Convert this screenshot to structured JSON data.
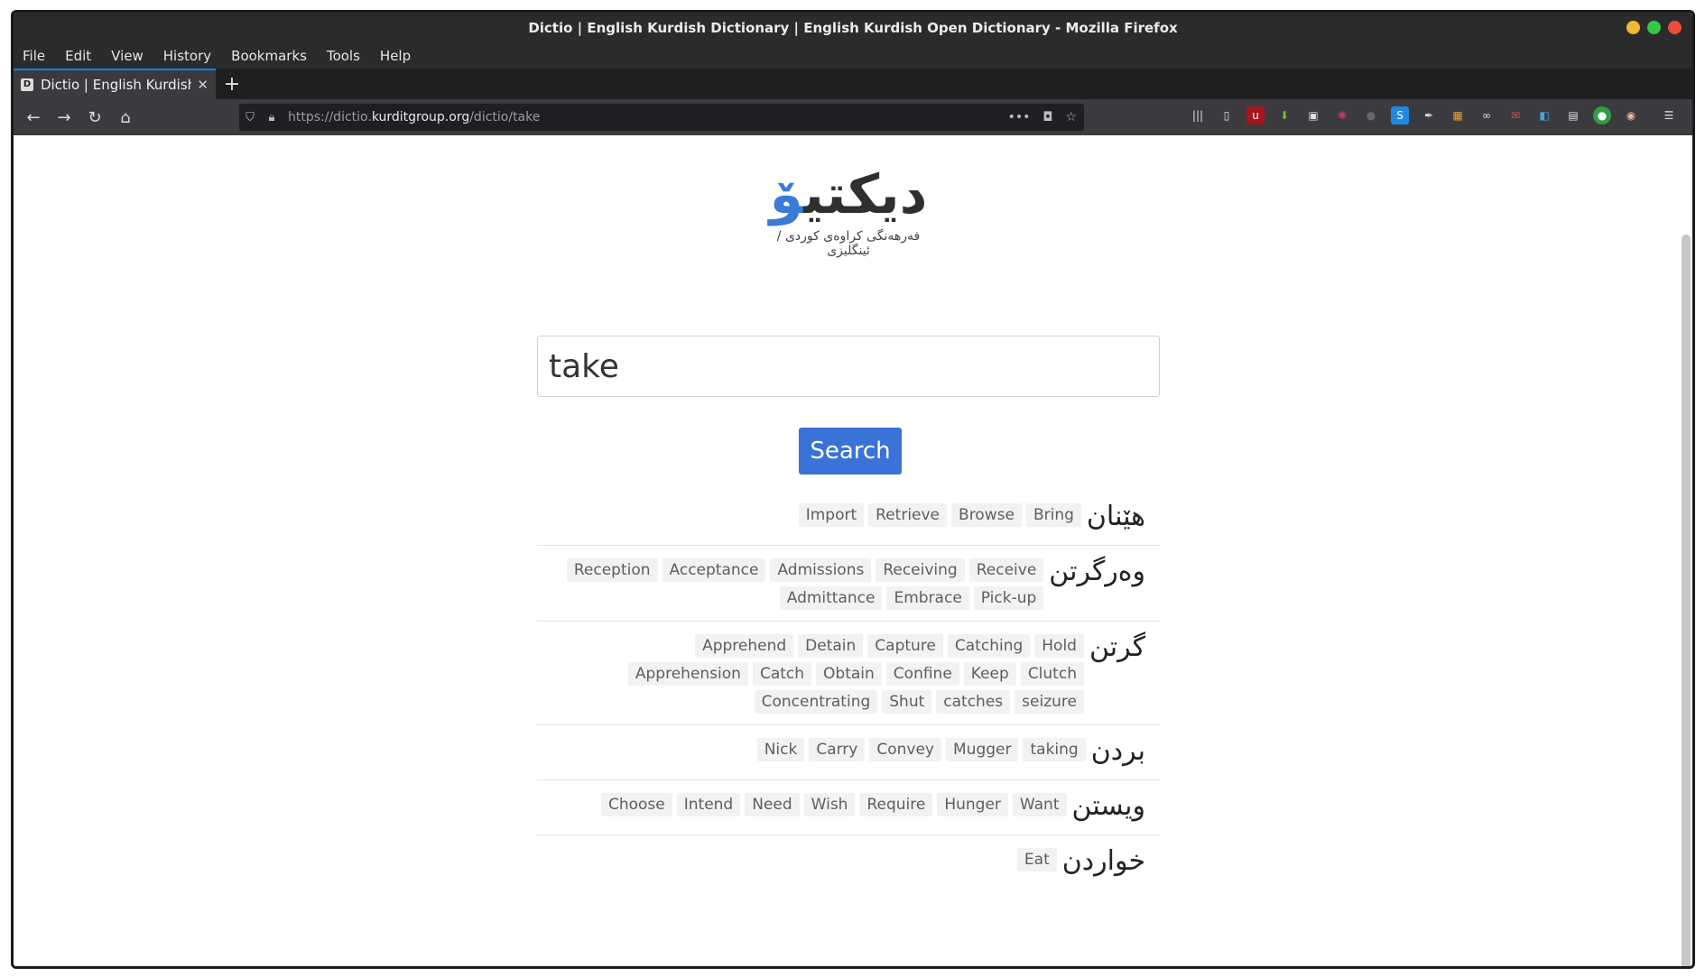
{
  "window": {
    "title": "Dictio | English Kurdish Dictionary | English Kurdish Open Dictionary - Mozilla Firefox",
    "controls": [
      {
        "name": "minimize",
        "color": "#f5b731"
      },
      {
        "name": "maximize",
        "color": "#37c84a"
      },
      {
        "name": "close",
        "color": "#ed4b3c"
      }
    ]
  },
  "menu": [
    "File",
    "Edit",
    "View",
    "History",
    "Bookmarks",
    "Tools",
    "Help"
  ],
  "tab": {
    "favicon": "D",
    "title": "Dictio | English Kurdish D",
    "close": "✕"
  },
  "url": {
    "scheme": "https://dictio.",
    "host": "kurditgroup.org",
    "path": "/dictio/take"
  },
  "logo": {
    "main_dark": "دیکتی",
    "main_accent": "ۆ",
    "subtitle": "فەرهەنگی کراوەی کوردی / ئینگلیزی"
  },
  "search": {
    "value": "take",
    "button": "Search"
  },
  "results": [
    {
      "kurdish": "هێنان",
      "words": [
        "Import",
        "Retrieve",
        "Browse",
        "Bring"
      ]
    },
    {
      "kurdish": "وەرگرتن",
      "words": [
        "Reception",
        "Acceptance",
        "Admissions",
        "Receiving",
        "Receive",
        "Admittance",
        "Embrace",
        "Pick-up"
      ]
    },
    {
      "kurdish": "گرتن",
      "words": [
        "Apprehend",
        "Detain",
        "Capture",
        "Catching",
        "Hold",
        "Apprehension",
        "Catch",
        "Obtain",
        "Confine",
        "Keep",
        "Clutch",
        "Concentrating",
        "Shut",
        "catches",
        "seizure"
      ]
    },
    {
      "kurdish": "بردن",
      "words": [
        "Nick",
        "Carry",
        "Convey",
        "Mugger",
        "taking"
      ]
    },
    {
      "kurdish": "ویستن",
      "words": [
        "Choose",
        "Intend",
        "Need",
        "Wish",
        "Require",
        "Hunger",
        "Want"
      ]
    },
    {
      "kurdish": "خواردن",
      "words": [
        "Eat"
      ]
    }
  ],
  "colors": {
    "accent": "#3a7bd5",
    "button": "#3a72d8",
    "tag_bg": "#f2f2f2"
  }
}
